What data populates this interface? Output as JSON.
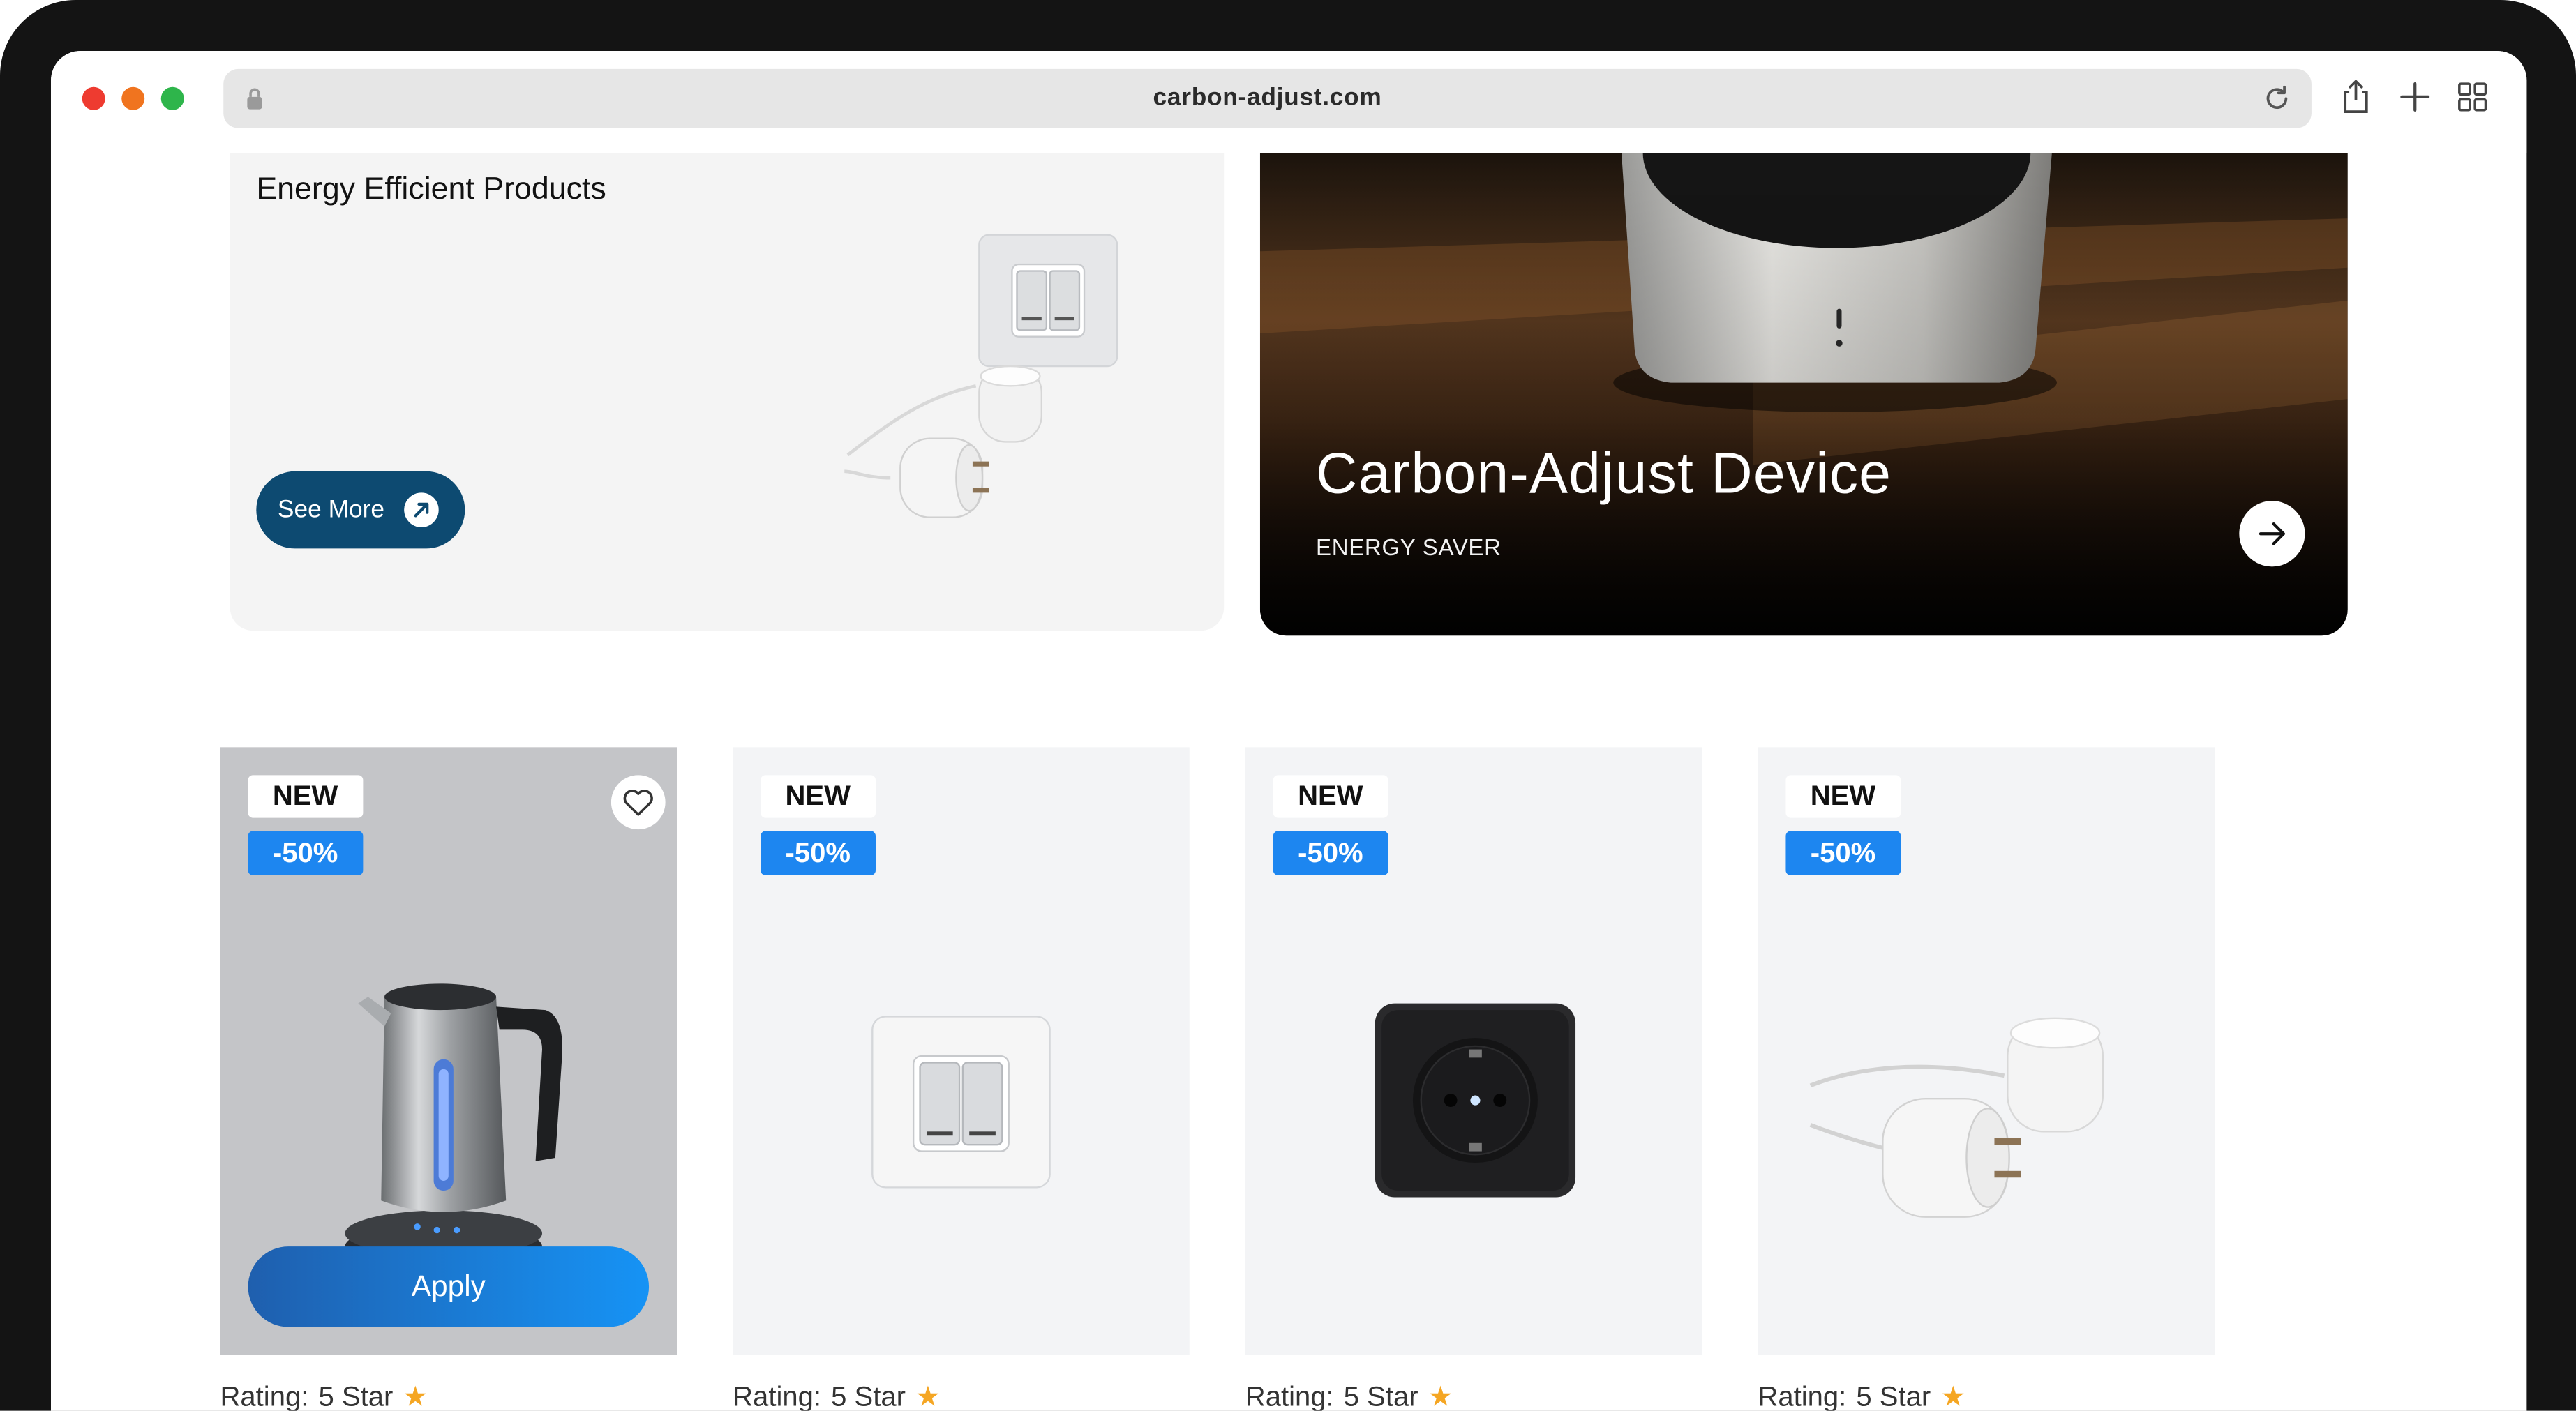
{
  "browser": {
    "url": "carbon-adjust.com",
    "icons": [
      "lock-icon",
      "reload-icon",
      "share-icon",
      "new-tab-icon",
      "tab-overview-icon"
    ]
  },
  "promo_products": {
    "title": "Energy Efficient Products",
    "button_label": "See More"
  },
  "promo_device": {
    "title": "Carbon-Adjust Device",
    "subtitle": "ENERGY SAVER"
  },
  "products": [
    {
      "badge_new": "NEW",
      "badge_discount": "-50%",
      "image": "kettle",
      "action_label": "Apply",
      "rating_label": "Rating:",
      "rating_value": "5 Star"
    },
    {
      "badge_new": "NEW",
      "badge_discount": "-50%",
      "image": "light-switch",
      "rating_label": "Rating:",
      "rating_value": "5 Star"
    },
    {
      "badge_new": "NEW",
      "badge_discount": "-50%",
      "image": "power-socket",
      "rating_label": "Rating:",
      "rating_value": "5 Star"
    },
    {
      "badge_new": "NEW",
      "badge_discount": "-50%",
      "image": "smart-plug",
      "rating_label": "Rating:",
      "rating_value": "5 Star"
    }
  ],
  "colors": {
    "primary_dark": "#0d4a71",
    "discount_blue": "#1d86f0",
    "star": "#f5a623"
  }
}
